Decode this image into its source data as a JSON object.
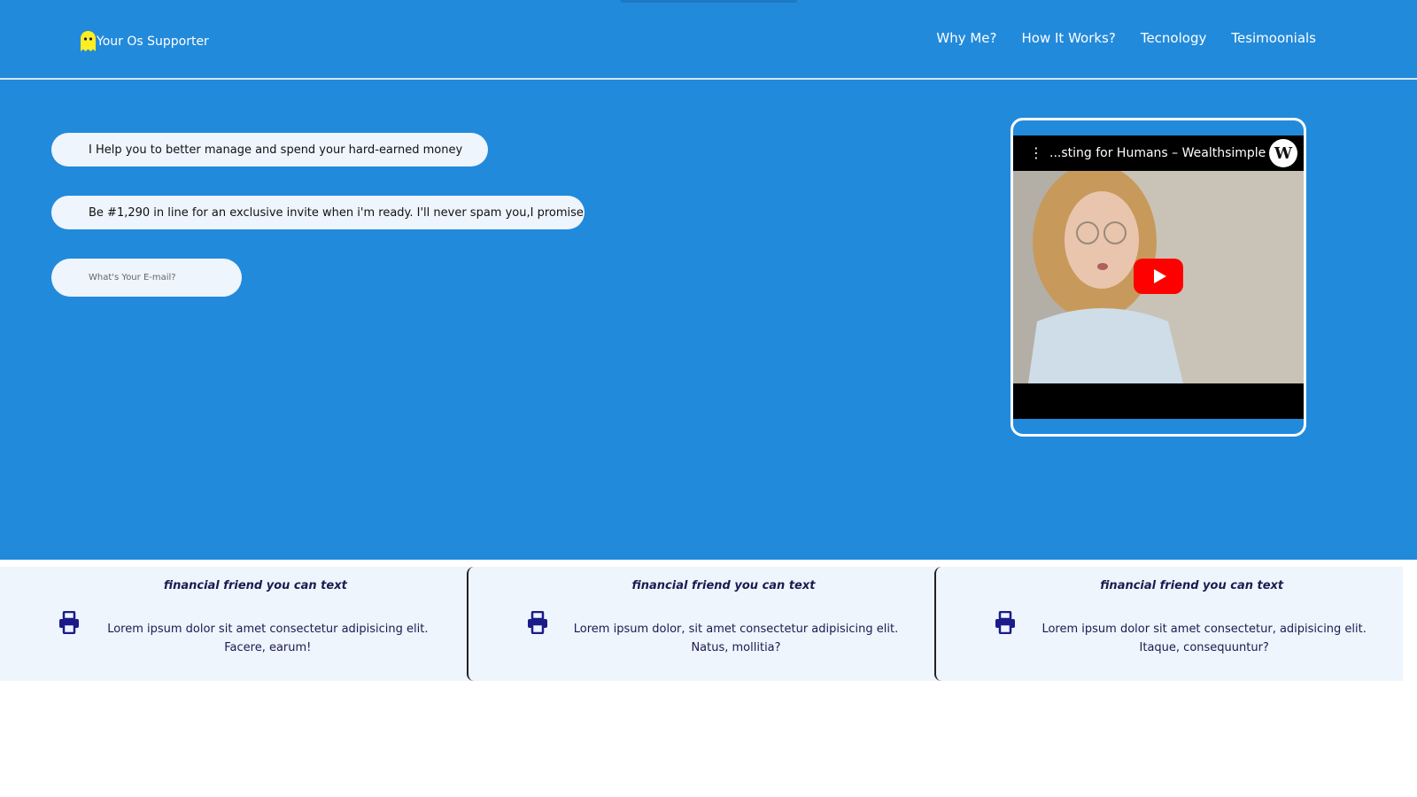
{
  "colors": {
    "hero_bg": "#228adb",
    "pill_bg": "#eef5fd",
    "card_bg": "#eef5fd",
    "card_text": "#1b1b4f",
    "ghost_logo": "#ffee22",
    "play_button": "#ff0000"
  },
  "brand": {
    "name": "Your Os Supporter",
    "icon": "ghost-icon"
  },
  "nav": {
    "items": [
      {
        "label": "Why Me?"
      },
      {
        "label": "How It Works?"
      },
      {
        "label": "Tecnology"
      },
      {
        "label": "Tesimoonials"
      }
    ]
  },
  "hero": {
    "headline": "I Help you to better manage and spend your hard-earned money",
    "subline": "Be #1,290 in line for an exclusive invite when i'm ready. I'll never spam you,I promise",
    "email_placeholder": "What's Your E-mail?"
  },
  "video": {
    "title": "...sting for Humans – Wealthsimple",
    "channel_logo_letter": "W",
    "menu_icon": "kebab-menu-icon",
    "play_icon": "play-icon"
  },
  "features": [
    {
      "title": "financial friend you can text",
      "icon": "printer-icon",
      "text": "Lorem ipsum dolor sit amet consectetur adipisicing elit. Facere, earum!"
    },
    {
      "title": "financial friend you can text",
      "icon": "printer-icon",
      "text": "Lorem ipsum dolor, sit amet consectetur adipisicing elit. Natus, mollitia?"
    },
    {
      "title": "financial friend you can text",
      "icon": "printer-icon",
      "text": "Lorem ipsum dolor sit amet consectetur, adipisicing elit. Itaque, consequuntur?"
    }
  ]
}
